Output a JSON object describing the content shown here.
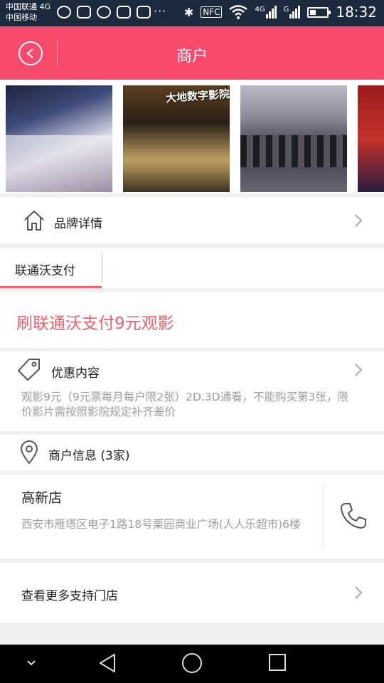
{
  "status_bar": {
    "carrier_line1": "中国联通 4G",
    "carrier_line2": "中国移动",
    "overflow": "···",
    "nfc": "NFC",
    "network_4g": "4G",
    "network_g": "G",
    "time": "18:32"
  },
  "header": {
    "title": "商户"
  },
  "gallery": {
    "photo2_sign": "大地数字影院"
  },
  "brand": {
    "label": "品牌详情"
  },
  "tabs": [
    {
      "label": "联通沃支付",
      "active": true
    }
  ],
  "promo": {
    "text": "刷联通沃支付9元观影"
  },
  "discount": {
    "title": "优惠内容",
    "description": "观影9元（9元票每月每户限2张）2D.3D通看，不能购买第3张，限价影片需按照影院规定补齐差价"
  },
  "merchant": {
    "label": "商户信息 (3家)"
  },
  "store": {
    "name": "高新店",
    "address": "西安市雁塔区电子1路18号栗园商业广场(人人乐超市)6楼"
  },
  "more": {
    "label": "查看更多支持门店"
  },
  "colors": {
    "accent": "#f84a6c",
    "promo": "#f0606e",
    "status_bar": "#1b2a3d"
  }
}
